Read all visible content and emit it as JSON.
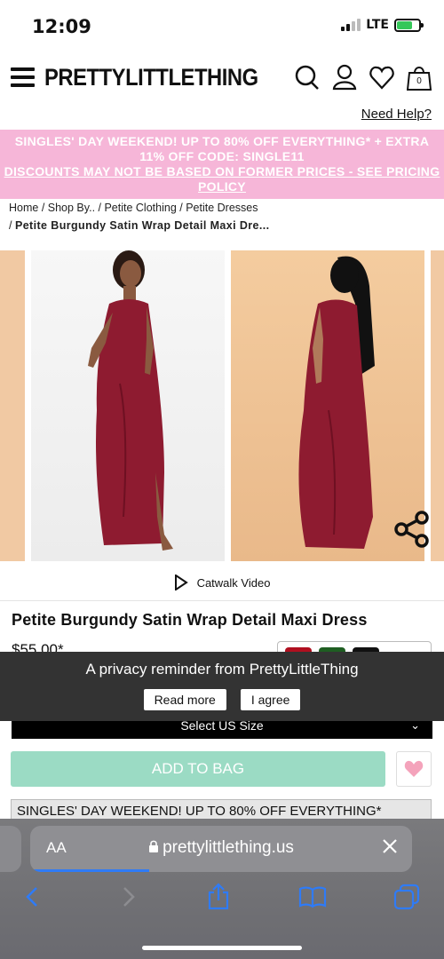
{
  "status": {
    "time": "12:09",
    "network": "LTE"
  },
  "header": {
    "logo": "PRETTYLITTLETHING",
    "cart_count": "0",
    "help": "Need Help?"
  },
  "promo": {
    "line1": "SINGLES' DAY WEEKEND! UP TO 80% OFF EVERYTHING* + EXTRA",
    "line2": "11% OFF CODE: SINGLE11",
    "link": "DISCOUNTS MAY NOT BE BASED ON FORMER PRICES - SEE PRICING POLICY"
  },
  "breadcrumb": {
    "items": [
      "Home",
      "Shop By..",
      "Petite Clothing",
      "Petite Dresses"
    ],
    "current": "Petite Burgundy Satin Wrap Detail Maxi Dre..."
  },
  "product": {
    "catwalk_label": "Catwalk Video",
    "title": "Petite Burgundy Satin Wrap Detail Maxi Dress",
    "price": "$55.00*",
    "swatch_colors": [
      "#b01020",
      "#1f5e22",
      "#111111"
    ],
    "size_select": "Select US Size",
    "add_to_bag": "ADD TO BAG"
  },
  "privacy": {
    "message": "A privacy reminder from PrettyLittleThing",
    "read_more": "Read more",
    "agree": "I agree"
  },
  "promo2": "SINGLES' DAY WEEKEND! UP TO 80% OFF EVERYTHING*",
  "safari": {
    "aa_label": "AA",
    "url": "prettylittlething.us"
  },
  "colors": {
    "promo_bg": "#f6b6d8",
    "add_to_bag": "#9bdbc4",
    "dress": "#8e1b30"
  }
}
